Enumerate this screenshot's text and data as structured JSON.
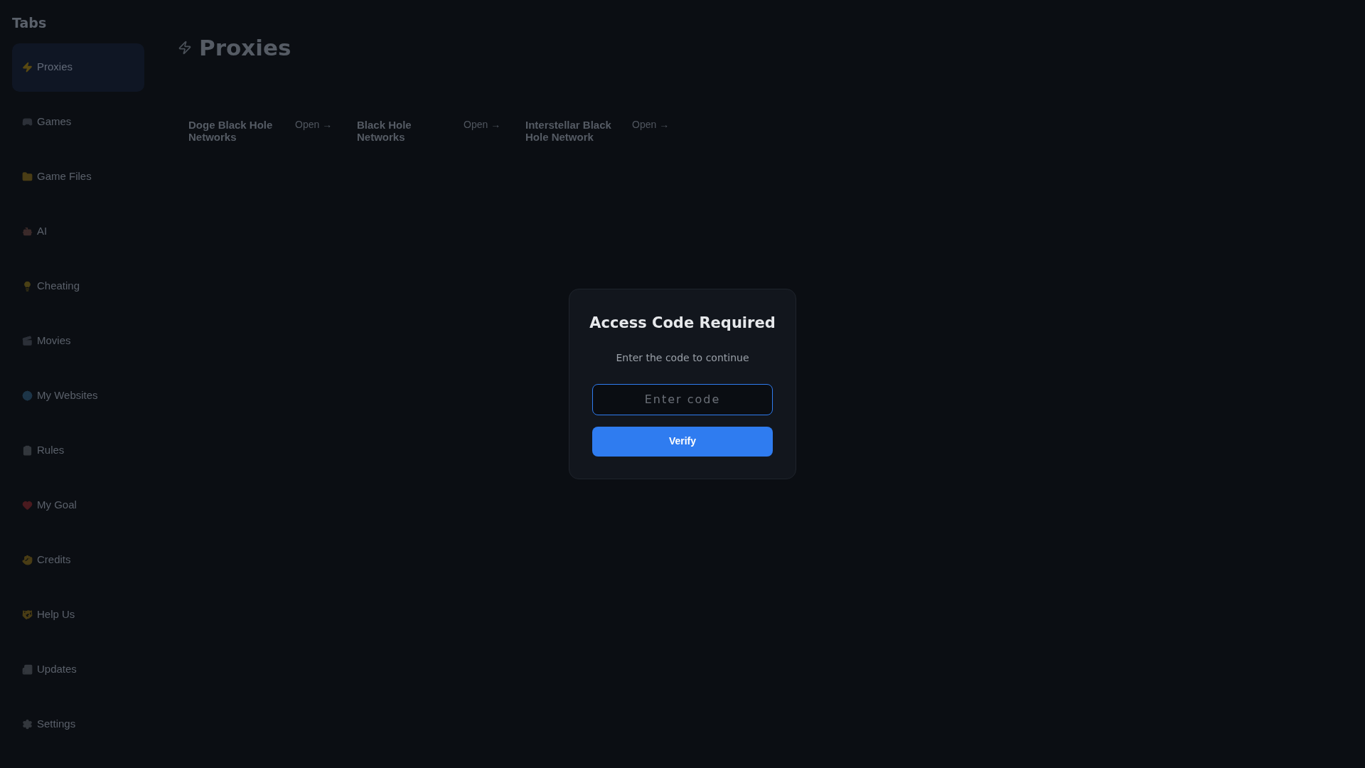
{
  "sidebar": {
    "title": "Tabs",
    "items": [
      {
        "label": "Proxies",
        "selected": true
      },
      {
        "label": "Games",
        "selected": false
      },
      {
        "label": "Game Files",
        "selected": false
      },
      {
        "label": "AI",
        "selected": false
      },
      {
        "label": "Cheating",
        "selected": false
      },
      {
        "label": "Movies",
        "selected": false
      },
      {
        "label": "My Websites",
        "selected": false
      },
      {
        "label": "Rules",
        "selected": false
      },
      {
        "label": "My Goal",
        "selected": false
      },
      {
        "label": "Credits",
        "selected": false
      },
      {
        "label": "Help Us",
        "selected": false
      },
      {
        "label": "Updates",
        "selected": false
      },
      {
        "label": "Settings",
        "selected": false
      }
    ]
  },
  "main": {
    "heading": "Proxies",
    "cards": [
      {
        "title": "Doge Black Hole Networks",
        "action": "Open →"
      },
      {
        "title": "Black Hole Networks",
        "action": "Open →"
      },
      {
        "title": "Interstellar Black Hole Network",
        "action": "Open →"
      }
    ]
  },
  "dialog": {
    "title": "Access Code Required",
    "subtitle": "Enter the code to continue",
    "field": {
      "placeholder": "Enter code",
      "focused": true
    },
    "button": "Verify"
  }
}
